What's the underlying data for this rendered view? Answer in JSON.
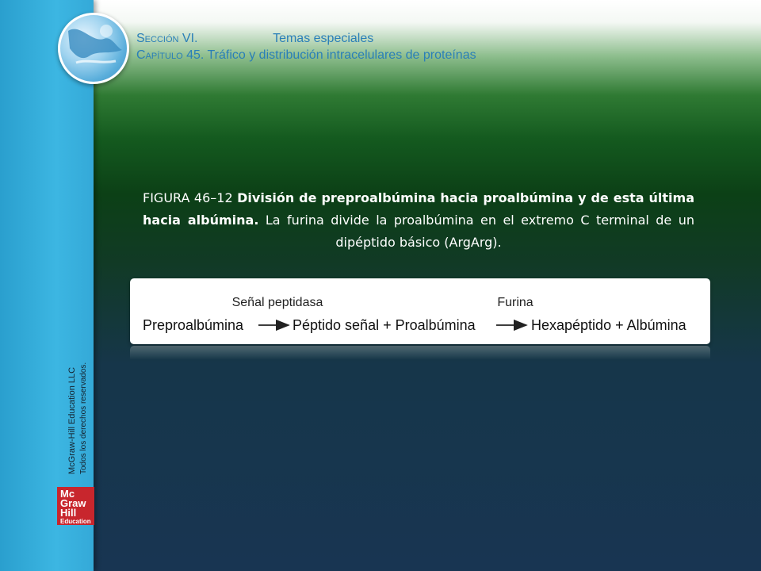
{
  "header": {
    "section_label": "Sección VI.",
    "section_title": "Temas especiales",
    "chapter_label": "Capítulo 45.",
    "chapter_title": "Tráfico y distribución intracelulares de proteínas"
  },
  "caption": {
    "figure_number": "FIGURA 46–12",
    "bold_text": "División de preproalbúmina hacia proalbúmina y de esta última hacia albúmina.",
    "body_text": "La furina divide la proalbúmina en el extremo C terminal de un dipéptido básico (ArgArg)."
  },
  "diagram": {
    "enzyme_1": "Señal peptidasa",
    "enzyme_2": "Furina",
    "substrate": "Preproalbúmina",
    "intermediate": "Péptido señal + Proalbúmina",
    "products": "Hexapéptido + Albúmina"
  },
  "copyright": {
    "line1": "McGraw-Hill Education LLC",
    "line2": "Todos los derechos reservados."
  },
  "brand": {
    "line1": "Mc",
    "line2": "Graw",
    "line3": "Hill",
    "line4": "Education"
  }
}
